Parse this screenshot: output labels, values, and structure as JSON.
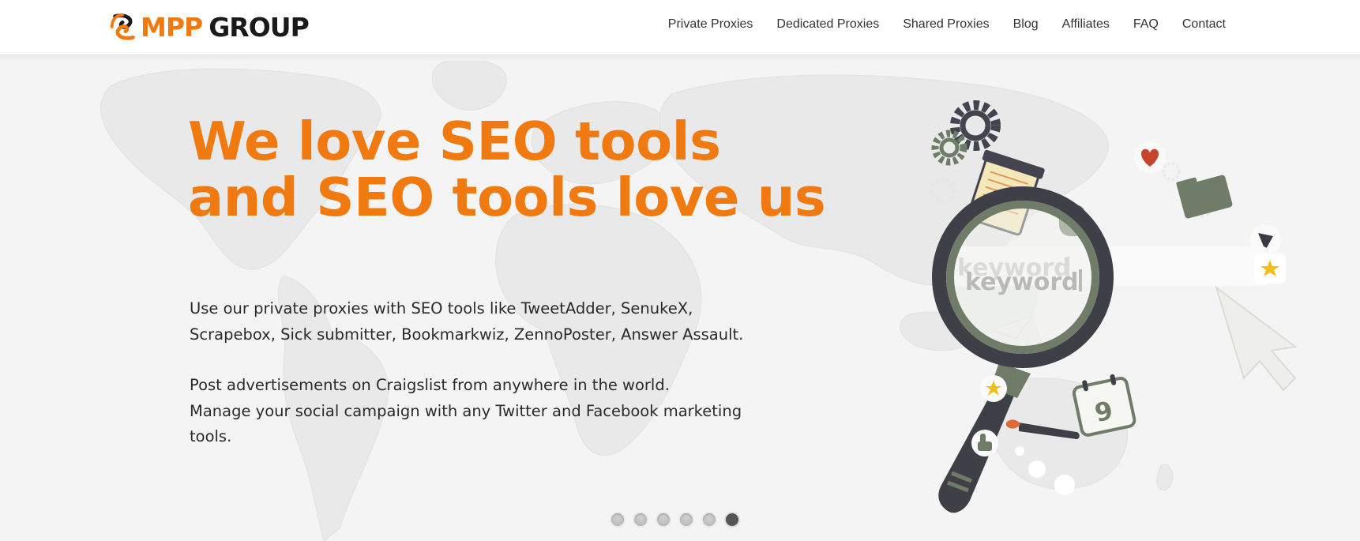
{
  "brand": {
    "mpp": "MPP",
    "group": "GROUP",
    "logo_icon": "mpp-swirl-logo-icon",
    "accent_color": "#f07a10"
  },
  "nav": {
    "items": [
      {
        "label": "Private Proxies"
      },
      {
        "label": "Dedicated Proxies"
      },
      {
        "label": "Shared Proxies"
      },
      {
        "label": "Blog"
      },
      {
        "label": "Affiliates"
      },
      {
        "label": "FAQ"
      },
      {
        "label": "Contact"
      }
    ]
  },
  "hero": {
    "headline_line1": "We love SEO tools",
    "headline_line2": "and SEO tools love us",
    "paragraph1_line1": "Use our private proxies with SEO tools like TweetAdder, SenukeX,",
    "paragraph1_line2": "Scrapebox, Sick submitter, Bookmarkwiz, ZennoPoster, Answer Assault.",
    "paragraph2_line1": "Post advertisements on Craigslist from anywhere in the world.",
    "paragraph2_line2": "Manage your social campaign with any Twitter and Facebook marketing",
    "paragraph2_line3": "tools.",
    "illustration": {
      "search_text": "keyword",
      "calendar_number": "9",
      "icons": [
        "magnifying-glass-icon",
        "gear-icon",
        "heart-icon",
        "folder-icon",
        "star-icon",
        "cursor-arrow-icon",
        "calendar-icon",
        "thumbs-up-icon",
        "paintbrush-icon",
        "envelope-icon",
        "notepad-icon"
      ]
    }
  },
  "slider": {
    "total": 6,
    "active_index": 6
  }
}
